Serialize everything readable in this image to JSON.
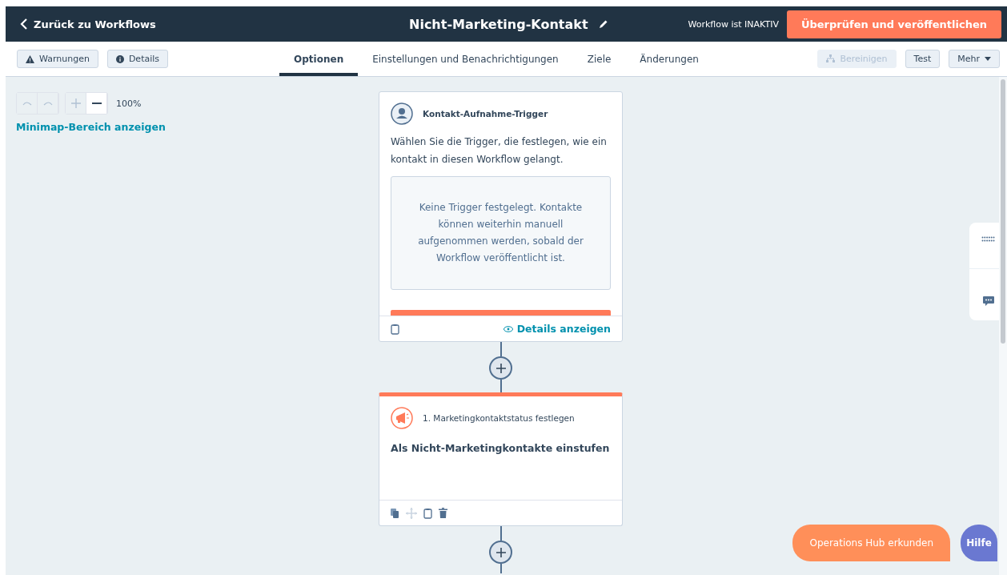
{
  "header": {
    "back_label": "Zurück zu Workflows",
    "title": "Nicht-Marketing-Kontakt",
    "status": "Workflow ist INAKTIV",
    "publish_button": "Überprüfen und veröffentlichen"
  },
  "toolbar": {
    "left_buttons": [
      {
        "label": "Warnungen",
        "kind": "warning"
      },
      {
        "label": "Details",
        "kind": "info"
      }
    ],
    "tabs": [
      {
        "label": "Optionen",
        "selected": true
      },
      {
        "label": "Einstellungen und Benachrichtigungen",
        "selected": false
      },
      {
        "label": "Ziele",
        "selected": false
      },
      {
        "label": "Änderungen",
        "selected": false
      }
    ],
    "right_buttons": [
      {
        "label": "Bereinigen",
        "kind": "cleanup",
        "disabled": true
      },
      {
        "label": "Test",
        "kind": "plain",
        "disabled": false
      },
      {
        "label": "Mehr",
        "kind": "dropdown",
        "disabled": false
      }
    ]
  },
  "canvas": {
    "zoom_level": "100%",
    "minimap_link": "Minimap-Bereich anzeigen",
    "trigger_card": {
      "title": "Kontakt-Aufnahme-Trigger",
      "description": "Wählen Sie die Trigger, die festlegen, wie ein kontakt in diesen Workflow gelangt.",
      "empty_text": "Keine Trigger festgelegt. Kontakte können weiterhin manuell aufgenommen werden, sobald der Workflow veröffentlicht ist.",
      "details_link": "Details anzeigen"
    },
    "action_card": {
      "title": "1. Marketingkontaktstatus festlegen",
      "body": "Als Nicht-Marketingkontakte einstufen"
    }
  },
  "explore_button": "Operations Hub erkunden",
  "help_button": "Hilfe"
}
